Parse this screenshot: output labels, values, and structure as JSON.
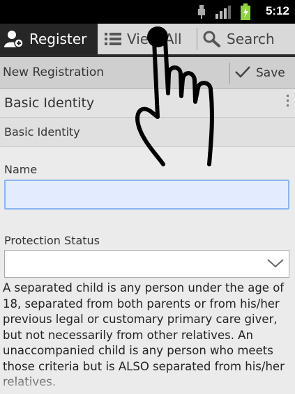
{
  "status_bar": {
    "time": "5:12",
    "icons": [
      "usb-icon",
      "signal-icon",
      "battery-icon"
    ]
  },
  "tabs": [
    {
      "label": "Register",
      "icon": "user-add-icon",
      "active": true
    },
    {
      "label": "View All",
      "icon": "list-icon",
      "active": false
    },
    {
      "label": "Search",
      "icon": "search-icon",
      "active": false
    }
  ],
  "action_bar": {
    "title": "New Registration",
    "save_label": "Save"
  },
  "section": {
    "title": "Basic Identity",
    "subtitle": "Basic Identity"
  },
  "fields": {
    "name_label": "Name",
    "name_value": "",
    "protection_label": "Protection Status",
    "protection_value": ""
  },
  "description": "A separated child is any person under the age of 18, separated from both parents or from his/her previous legal or customary primary care giver, but not necessarily from other relatives. An unaccompanied child is any person who meets those criteria but is ALSO separated from his/her relatives.",
  "colors": {
    "status_bar": "#000000",
    "active_tab": "#262626",
    "input_focus": "#8ab4f0"
  }
}
